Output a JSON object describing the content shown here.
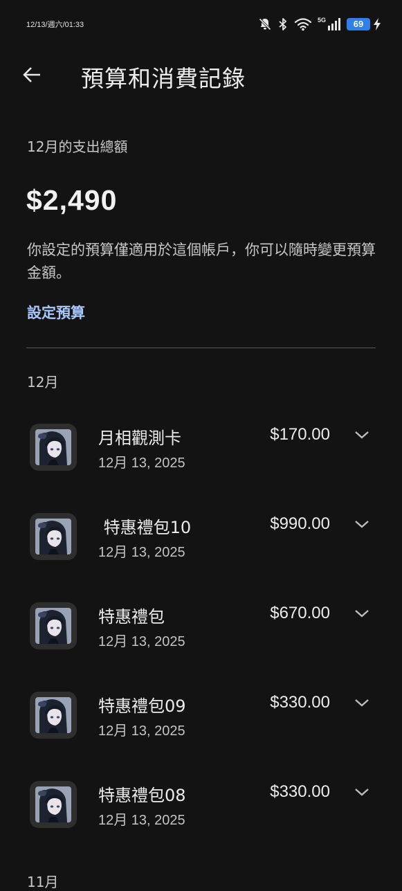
{
  "status_bar": {
    "time": "12/13/週六/01:33",
    "network": "5G",
    "battery": "69"
  },
  "header": {
    "title": "預算和消費記錄"
  },
  "summary": {
    "subtitle": "12月的支出總額",
    "total": "$2,490",
    "description": "你設定的預算僅適用於這個帳戶，你可以隨時變更預算金額。",
    "set_budget_label": "設定預算"
  },
  "months": [
    {
      "label": "12月",
      "transactions": [
        {
          "name": "月相觀測卡",
          "date": "12月 13, 2025",
          "amount": "$170.00"
        },
        {
          "name": " 特惠禮包10",
          "date": "12月 13, 2025",
          "amount": "$990.00"
        },
        {
          "name": "特惠禮包",
          "date": "12月 13, 2025",
          "amount": "$670.00"
        },
        {
          "name": "特惠禮包09",
          "date": "12月 13, 2025",
          "amount": "$330.00"
        },
        {
          "name": "特惠禮包08",
          "date": "12月 13, 2025",
          "amount": "$330.00"
        }
      ]
    },
    {
      "label": "11月",
      "transactions": []
    }
  ],
  "icons": {
    "back": "arrow-back-icon",
    "expand": "chevron-down-icon",
    "app": "game-character-icon",
    "mute": "bell-off-icon",
    "bluetooth": "bluetooth-icon",
    "wifi": "wifi-icon",
    "signal": "signal-icon",
    "charging": "lightning-icon"
  },
  "colors": {
    "background": "#131313",
    "accent": "#a8c7fa",
    "battery": "#2f80ed"
  }
}
